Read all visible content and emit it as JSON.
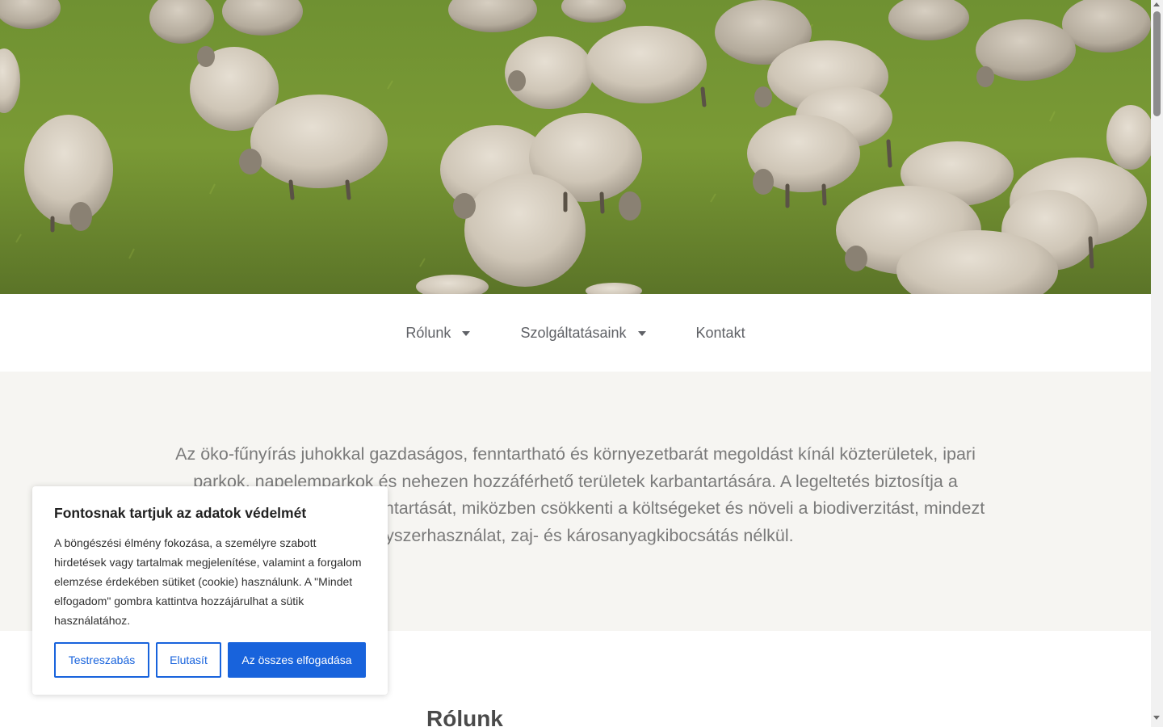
{
  "hero": {
    "image": "grazing-sheep-photo"
  },
  "nav": {
    "items": [
      {
        "label": "Rólunk",
        "has_dropdown": true
      },
      {
        "label": "Szolgáltatásaink",
        "has_dropdown": true
      },
      {
        "label": "Kontakt",
        "has_dropdown": false
      }
    ]
  },
  "intro": {
    "text": "Az öko-fűnyírás juhokkal gazdaságos, fenntartható és környezetbarát megoldást kínál közterületek, ipari parkok, napelemparkok és nehezen hozzáférhető területek karbantartására. A legeltetés biztosítja a növényzet rendszeres karbantartását, miközben csökkenti a költségeket és növeli a biodiverzitást, mindezt vegyszerhasználat, zaj- és károsanyagkibocsátás nélkül."
  },
  "about": {
    "heading": "Rólunk"
  },
  "cookie": {
    "title": "Fontosnak tartjuk az adatok védelmét",
    "text": "A böngészési élmény fokozása, a személyre szabott hirdetések vagy tartalmak megjelenítése, valamint a forgalom elemzése érdekében sütiket (cookie) használunk. A \"Mindet elfogadom\" gombra kattintva hozzájárulhat a sütik használatához.",
    "customize_label": "Testreszabás",
    "reject_label": "Elutasít",
    "accept_label": "Az összes elfogadása"
  },
  "colors": {
    "accent": "#1863dc",
    "intro_bg": "#f6f5f2",
    "nav_text": "#5f6166"
  }
}
